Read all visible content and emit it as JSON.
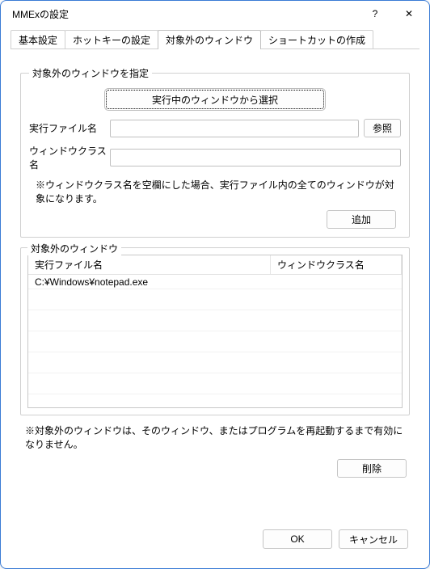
{
  "window": {
    "title": "MMExの設定"
  },
  "titlebar": {
    "help_icon": "?",
    "close_icon": "✕"
  },
  "tabs": [
    {
      "label": "基本設定"
    },
    {
      "label": "ホットキーの設定"
    },
    {
      "label": "対象外のウィンドウ"
    },
    {
      "label": "ショートカットの作成"
    }
  ],
  "group_specify": {
    "legend": "対象外のウィンドウを指定",
    "select_running_label": "実行中のウィンドウから選択",
    "exec_file_label": "実行ファイル名",
    "exec_file_value": "",
    "browse_label": "参照",
    "window_class_label": "ウィンドウクラス名",
    "window_class_value": "",
    "note": "※ウィンドウクラス名を空欄にした場合、実行ファイル内の全てのウィンドウが対象になります。",
    "add_label": "追加"
  },
  "group_list": {
    "legend": "対象外のウィンドウ",
    "columns": {
      "a": "実行ファイル名",
      "b": "ウィンドウクラス名"
    },
    "rows": [
      {
        "a": "C:¥Windows¥notepad.exe",
        "b": ""
      }
    ]
  },
  "bottom_note": "※対象外のウィンドウは、そのウィンドウ、またはプログラムを再起動するまで有効になりません。",
  "delete_label": "削除",
  "dialog": {
    "ok": "OK",
    "cancel": "キャンセル"
  }
}
